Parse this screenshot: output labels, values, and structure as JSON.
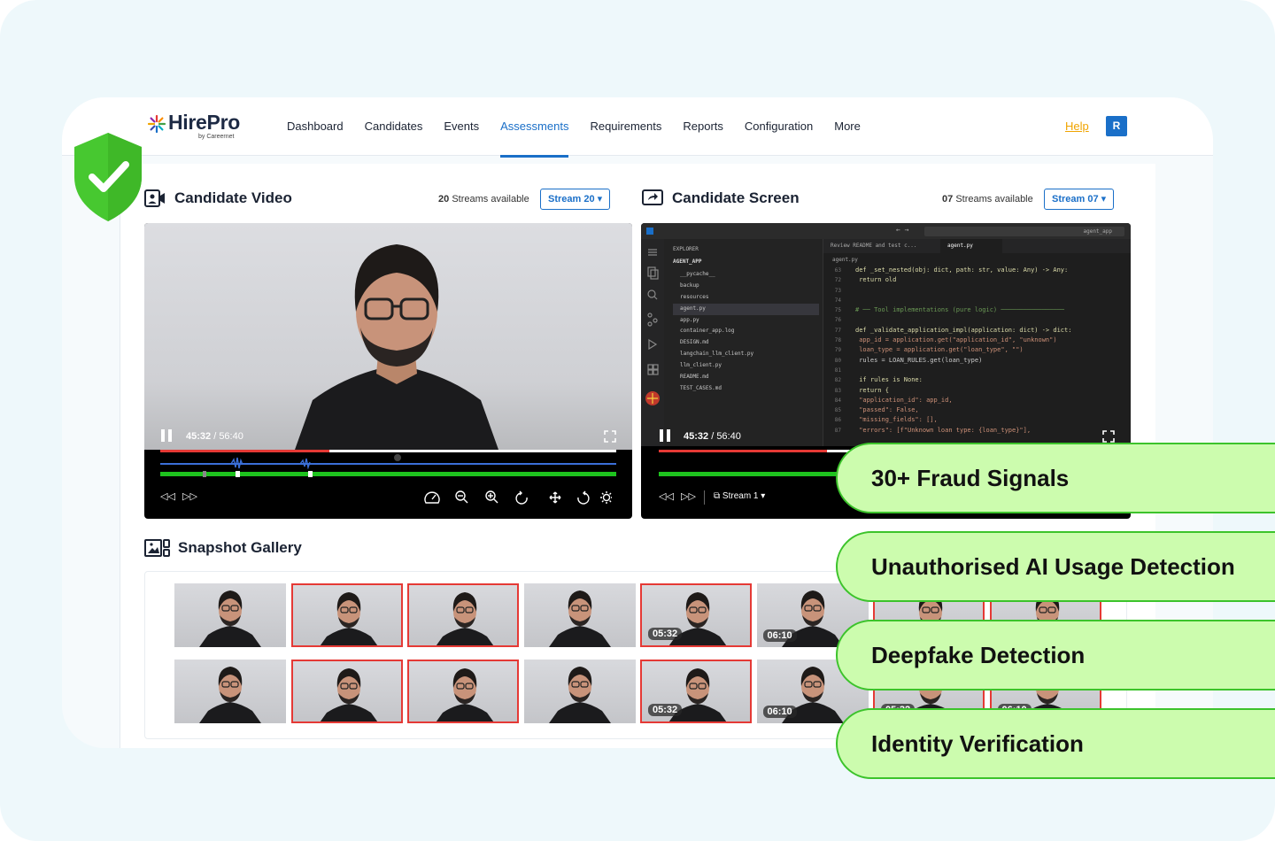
{
  "brand": {
    "name": "HirePro",
    "tagline": "by Careernet"
  },
  "nav": {
    "items": [
      "Dashboard",
      "Candidates",
      "Events",
      "Assessments",
      "Requirements",
      "Reports",
      "Configuration",
      "More"
    ],
    "active": "Assessments",
    "help_label": "Help",
    "avatar_initial": "R"
  },
  "candidate_video": {
    "title": "Candidate Video",
    "streams_count": "20",
    "streams_text": "Streams available",
    "stream_button": "Stream 20",
    "time_current": "45:32",
    "time_total": "56:40",
    "progress_fraction": 0.37
  },
  "candidate_screen": {
    "title": "Candidate Screen",
    "streams_count": "07",
    "streams_text": "Streams available",
    "stream_button": "Stream 07",
    "time_current": "45:32",
    "time_total": "56:40",
    "stream_selector": "Stream 1",
    "ide": {
      "search": "agent_app",
      "explorer_title": "EXPLORER",
      "project": "AGENT_APP",
      "files": [
        "__pycache__",
        "backup",
        "resources",
        "agent.py",
        "app.py",
        "container_app.log",
        "DESIGN.md",
        "langchain_llm_client.py",
        "llm_client.py",
        "README.md",
        "TEST_CASES.md"
      ],
      "tabs": [
        "Review README and test c...",
        "agent.py"
      ],
      "breadcrumb": "agent.py",
      "code_lines": [
        {
          "n": "63",
          "t": "def _set_nested(obj: dict, path: str, value: Any) -> Any:"
        },
        {
          "n": "72",
          "t": "    return old"
        },
        {
          "n": "73",
          "t": ""
        },
        {
          "n": "74",
          "t": ""
        },
        {
          "n": "75",
          "t": "# ── Tool implementations (pure logic) ─────────────────"
        },
        {
          "n": "76",
          "t": ""
        },
        {
          "n": "77",
          "t": "def _validate_application_impl(application: dict) -> dict:"
        },
        {
          "n": "78",
          "t": "    app_id = application.get(\"application_id\", \"unknown\")"
        },
        {
          "n": "79",
          "t": "    loan_type = application.get(\"loan_type\", \"\")"
        },
        {
          "n": "80",
          "t": "    rules = LOAN_RULES.get(loan_type)"
        },
        {
          "n": "81",
          "t": ""
        },
        {
          "n": "82",
          "t": "    if rules is None:"
        },
        {
          "n": "83",
          "t": "        return {"
        },
        {
          "n": "84",
          "t": "            \"application_id\": app_id,"
        },
        {
          "n": "85",
          "t": "            \"passed\": False,"
        },
        {
          "n": "86",
          "t": "            \"missing_fields\": [],"
        },
        {
          "n": "87",
          "t": "            \"errors\": [f\"Unknown loan type: {loan_type}\"],"
        }
      ]
    }
  },
  "snapshot_gallery": {
    "title": "Snapshot Gallery",
    "rows": [
      [
        {
          "flag": false,
          "ts": ""
        },
        {
          "flag": true,
          "ts": ""
        },
        {
          "flag": true,
          "ts": ""
        },
        {
          "flag": false,
          "ts": ""
        },
        {
          "flag": true,
          "ts": "05:32"
        },
        {
          "flag": false,
          "ts": "06:10"
        },
        {
          "flag": true,
          "ts": ""
        },
        {
          "flag": true,
          "ts": ""
        }
      ],
      [
        {
          "flag": false,
          "ts": ""
        },
        {
          "flag": true,
          "ts": ""
        },
        {
          "flag": true,
          "ts": ""
        },
        {
          "flag": false,
          "ts": ""
        },
        {
          "flag": true,
          "ts": "05:32"
        },
        {
          "flag": false,
          "ts": "06:10"
        },
        {
          "flag": true,
          "ts": "05:32"
        },
        {
          "flag": true,
          "ts": "06:10"
        }
      ]
    ]
  },
  "features": [
    "30+ Fraud Signals",
    "Unauthorised AI Usage Detection",
    "Deepfake Detection",
    "Identity Verification"
  ],
  "colors": {
    "accent": "#1a6fc8",
    "help": "#f0a400",
    "flag": "#e53935",
    "pill_bg": "#ccfcae",
    "pill_border": "#3cc32b",
    "shield": "#47c830"
  }
}
